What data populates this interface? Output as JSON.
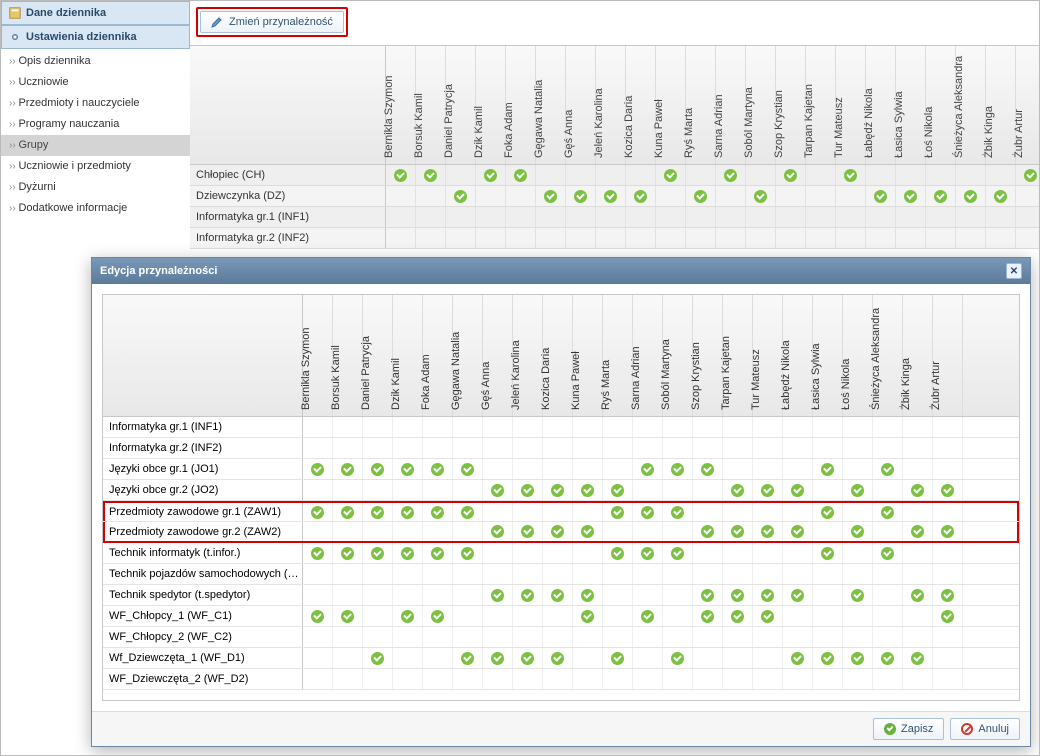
{
  "sidebar": {
    "heading1": "Dane dziennika",
    "heading2": "Ustawienia dziennika",
    "items": [
      "Opis dziennika",
      "Uczniowie",
      "Przedmioty i nauczyciele",
      "Programy nauczania",
      "Grupy",
      "Uczniowie i przedmioty",
      "Dyżurni",
      "Dodatkowe informacje"
    ],
    "active_index": 4
  },
  "toolbar": {
    "change_label": "Zmień przynależność"
  },
  "students": [
    "Bernikla Szymon",
    "Borsuk Kamil",
    "Daniel Patrycja",
    "Dzik Kamil",
    "Foka Adam",
    "Gęgawa Natalia",
    "Gęś Anna",
    "Jeleń Karolina",
    "Kozica Daria",
    "Kuna Paweł",
    "Ryś Marta",
    "Sarna Adrian",
    "Soból Martyna",
    "Szop Krystian",
    "Tarpan Kajetan",
    "Tur Mateusz",
    "Łabędź Nikola",
    "Łasica Sylwia",
    "Łoś Nikola",
    "Śnieżyca Aleksandra",
    "Żbik Kinga",
    "Żubr Artur"
  ],
  "bg_groups": [
    {
      "label": "Chłopiec (CH)",
      "marks": [
        1,
        1,
        0,
        1,
        1,
        0,
        0,
        0,
        0,
        1,
        0,
        1,
        0,
        1,
        0,
        1,
        0,
        0,
        0,
        0,
        0,
        1
      ]
    },
    {
      "label": "Dziewczynka (DZ)",
      "marks": [
        0,
        0,
        1,
        0,
        0,
        1,
        1,
        1,
        1,
        0,
        1,
        0,
        1,
        0,
        0,
        0,
        1,
        1,
        1,
        1,
        1,
        0
      ]
    },
    {
      "label": "Informatyka gr.1 (INF1)",
      "marks": [
        0,
        0,
        0,
        0,
        0,
        0,
        0,
        0,
        0,
        0,
        0,
        0,
        0,
        0,
        0,
        0,
        0,
        0,
        0,
        0,
        0,
        0
      ]
    },
    {
      "label": "Informatyka gr.2 (INF2)",
      "marks": [
        0,
        0,
        0,
        0,
        0,
        0,
        0,
        0,
        0,
        0,
        0,
        0,
        0,
        0,
        0,
        0,
        0,
        0,
        0,
        0,
        0,
        0
      ]
    }
  ],
  "modal": {
    "title": "Edycja przynależności",
    "save": "Zapisz",
    "cancel": "Anuluj",
    "highlight_rows": [
      4,
      5
    ],
    "groups": [
      {
        "label": "Informatyka gr.1 (INF1)",
        "marks": [
          0,
          0,
          0,
          0,
          0,
          0,
          0,
          0,
          0,
          0,
          0,
          0,
          0,
          0,
          0,
          0,
          0,
          0,
          0,
          0,
          0,
          0
        ]
      },
      {
        "label": "Informatyka gr.2 (INF2)",
        "marks": [
          0,
          0,
          0,
          0,
          0,
          0,
          0,
          0,
          0,
          0,
          0,
          0,
          0,
          0,
          0,
          0,
          0,
          0,
          0,
          0,
          0,
          0
        ]
      },
      {
        "label": "Języki obce gr.1 (JO1)",
        "marks": [
          1,
          1,
          1,
          1,
          1,
          1,
          0,
          0,
          0,
          0,
          0,
          1,
          1,
          1,
          0,
          0,
          0,
          1,
          0,
          1,
          0,
          0
        ]
      },
      {
        "label": "Języki obce gr.2 (JO2)",
        "marks": [
          0,
          0,
          0,
          0,
          0,
          0,
          1,
          1,
          1,
          1,
          1,
          0,
          0,
          0,
          1,
          1,
          1,
          0,
          1,
          0,
          1,
          1
        ]
      },
      {
        "label": "Przedmioty zawodowe gr.1 (ZAW1)",
        "marks": [
          1,
          1,
          1,
          1,
          1,
          1,
          0,
          0,
          0,
          0,
          1,
          1,
          1,
          0,
          0,
          0,
          0,
          1,
          0,
          1,
          0,
          0
        ]
      },
      {
        "label": "Przedmioty zawodowe gr.2 (ZAW2)",
        "marks": [
          0,
          0,
          0,
          0,
          0,
          0,
          1,
          1,
          1,
          1,
          0,
          0,
          0,
          1,
          1,
          1,
          1,
          0,
          1,
          0,
          1,
          1
        ]
      },
      {
        "label": "Technik informatyk (t.infor.)",
        "marks": [
          1,
          1,
          1,
          1,
          1,
          1,
          0,
          0,
          0,
          0,
          1,
          1,
          1,
          0,
          0,
          0,
          0,
          1,
          0,
          1,
          0,
          0
        ]
      },
      {
        "label": "Technik pojazdów samochodowych (…",
        "marks": [
          0,
          0,
          0,
          0,
          0,
          0,
          0,
          0,
          0,
          0,
          0,
          0,
          0,
          0,
          0,
          0,
          0,
          0,
          0,
          0,
          0,
          0
        ]
      },
      {
        "label": "Technik spedytor (t.spedytor)",
        "marks": [
          0,
          0,
          0,
          0,
          0,
          0,
          1,
          1,
          1,
          1,
          0,
          0,
          0,
          1,
          1,
          1,
          1,
          0,
          1,
          0,
          1,
          1
        ]
      },
      {
        "label": "WF_Chłopcy_1 (WF_C1)",
        "marks": [
          1,
          1,
          0,
          1,
          1,
          0,
          0,
          0,
          0,
          1,
          0,
          1,
          0,
          1,
          1,
          1,
          0,
          0,
          0,
          0,
          0,
          1
        ]
      },
      {
        "label": "WF_Chłopcy_2 (WF_C2)",
        "marks": [
          0,
          0,
          0,
          0,
          0,
          0,
          0,
          0,
          0,
          0,
          0,
          0,
          0,
          0,
          0,
          0,
          0,
          0,
          0,
          0,
          0,
          0
        ]
      },
      {
        "label": "Wf_Dziewczęta_1 (WF_D1)",
        "marks": [
          0,
          0,
          1,
          0,
          0,
          1,
          1,
          1,
          1,
          0,
          1,
          0,
          1,
          0,
          0,
          0,
          1,
          1,
          1,
          1,
          1,
          0
        ]
      },
      {
        "label": "WF_Dziewczęta_2 (WF_D2)",
        "marks": [
          0,
          0,
          0,
          0,
          0,
          0,
          0,
          0,
          0,
          0,
          0,
          0,
          0,
          0,
          0,
          0,
          0,
          0,
          0,
          0,
          0,
          0
        ]
      }
    ]
  }
}
